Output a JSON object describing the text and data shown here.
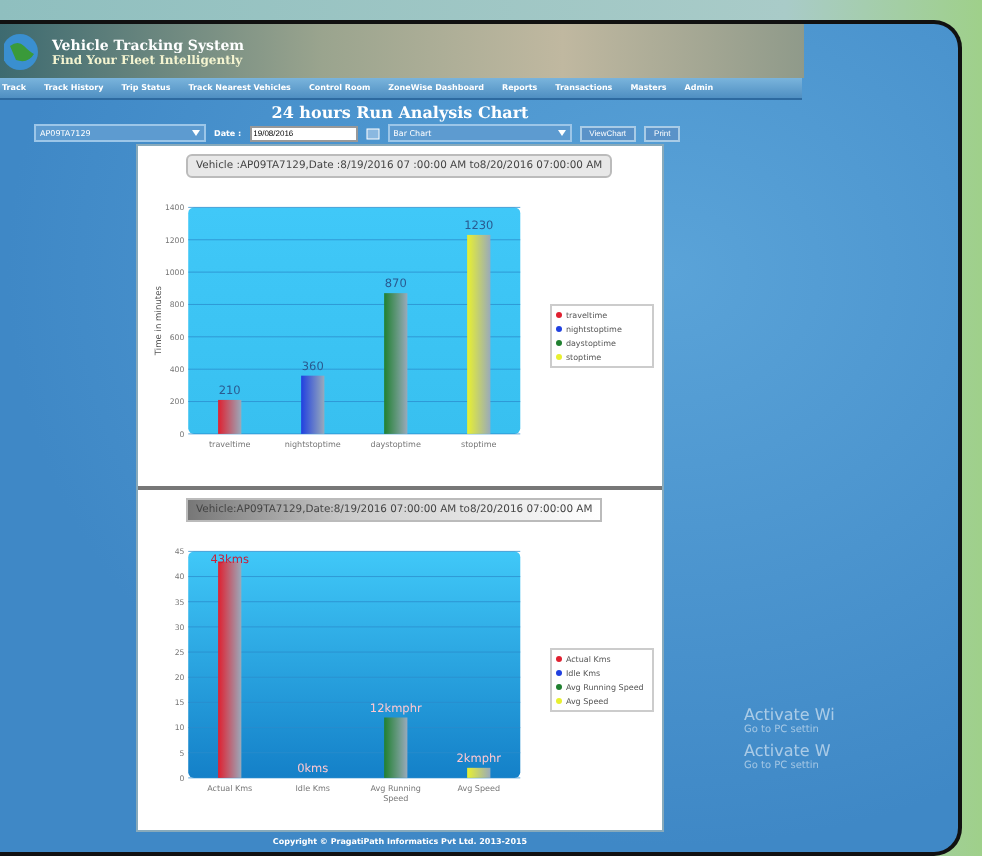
{
  "header": {
    "title": "Vehicle Tracking System",
    "tagline": "Find Your Fleet Intelligently"
  },
  "nav": [
    "Track",
    "Track History",
    "Trip Status",
    "Track Nearest Vehicles",
    "Control Room",
    "ZoneWise Dashboard",
    "Reports",
    "Transactions",
    "Masters",
    "Admin"
  ],
  "page_title": "24 hours Run Analysis Chart",
  "controls": {
    "vehicle": "AP09TA7129",
    "date_label": "Date :",
    "date": "19/08/2016",
    "chart_type": "Bar Chart",
    "buttons": [
      "ViewChart",
      "Print"
    ]
  },
  "charts": [
    {
      "caption": "Vehicle :AP09TA7129,Date :8/19/2016 07 :00:00 AM to8/20/2016 07:00:00 AM",
      "caption_highlighted": false,
      "legend": [
        {
          "label": "traveltime",
          "color": "#e02030"
        },
        {
          "label": "nightstoptime",
          "color": "#2040e0"
        },
        {
          "label": "daystoptime",
          "color": "#208030"
        },
        {
          "label": "stoptime",
          "color": "#e8f030"
        }
      ],
      "chart_data": {
        "type": "bar",
        "ylabel": "Time in minutes",
        "categories": [
          "traveltime",
          "nightstoptime",
          "daystoptime",
          "stoptime"
        ],
        "values": [
          210,
          360,
          870,
          1230
        ],
        "grid": true,
        "ylim": [
          0,
          1400
        ],
        "yticks": [
          0,
          200,
          400,
          600,
          800,
          1000,
          1200,
          1400
        ],
        "value_labels": [
          "210",
          "360",
          "870",
          "1230"
        ]
      }
    },
    {
      "caption": "Vehicle:AP09TA7129,Date:8/19/2016 07:00:00 AM to8/20/2016 07:00:00 AM",
      "caption_highlighted": true,
      "legend": [
        {
          "label": "Actual Kms",
          "color": "#e02030"
        },
        {
          "label": "Idle Kms",
          "color": "#2040e0"
        },
        {
          "label": "Avg Running Speed",
          "color": "#208030"
        },
        {
          "label": "Avg Speed",
          "color": "#e8f030"
        }
      ],
      "chart_data": {
        "type": "bar",
        "categories": [
          "Actual Kms",
          "Idle Kms",
          "Avg Running Speed",
          "Avg Speed"
        ],
        "values": [
          43,
          0,
          12,
          2
        ],
        "grid": true,
        "ylim": [
          0,
          45
        ],
        "yticks": [
          0,
          5,
          10,
          15,
          20,
          25,
          30,
          35,
          40,
          45
        ],
        "value_labels": [
          "43kms",
          "0kms",
          "12kmphr",
          "2kmphr"
        ]
      }
    }
  ],
  "footer": "Copyright © PragatiPath Informatics Pvt Ltd. 2013-2015",
  "system_notice": [
    {
      "title": "Activate Wi",
      "detail": "Go to PC settin"
    },
    {
      "title": "Activate W",
      "detail": "Go to PC settin"
    }
  ]
}
